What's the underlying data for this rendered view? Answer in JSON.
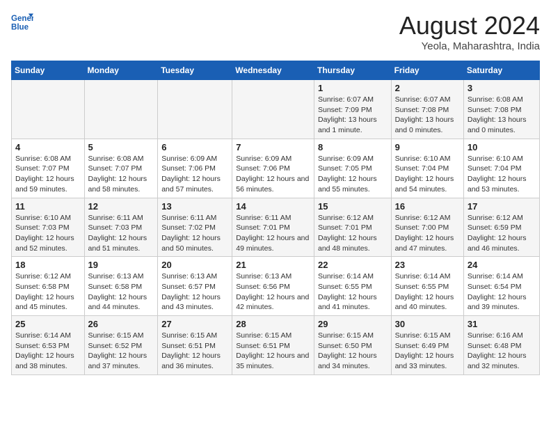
{
  "header": {
    "logo_line1": "General",
    "logo_line2": "Blue",
    "title": "August 2024",
    "subtitle": "Yeola, Maharashtra, India"
  },
  "days_of_week": [
    "Sunday",
    "Monday",
    "Tuesday",
    "Wednesday",
    "Thursday",
    "Friday",
    "Saturday"
  ],
  "weeks": [
    [
      {
        "num": "",
        "sunrise": "",
        "sunset": "",
        "daylight": ""
      },
      {
        "num": "",
        "sunrise": "",
        "sunset": "",
        "daylight": ""
      },
      {
        "num": "",
        "sunrise": "",
        "sunset": "",
        "daylight": ""
      },
      {
        "num": "",
        "sunrise": "",
        "sunset": "",
        "daylight": ""
      },
      {
        "num": "1",
        "sunrise": "Sunrise: 6:07 AM",
        "sunset": "Sunset: 7:09 PM",
        "daylight": "Daylight: 13 hours and 1 minute."
      },
      {
        "num": "2",
        "sunrise": "Sunrise: 6:07 AM",
        "sunset": "Sunset: 7:08 PM",
        "daylight": "Daylight: 13 hours and 0 minutes."
      },
      {
        "num": "3",
        "sunrise": "Sunrise: 6:08 AM",
        "sunset": "Sunset: 7:08 PM",
        "daylight": "Daylight: 13 hours and 0 minutes."
      }
    ],
    [
      {
        "num": "4",
        "sunrise": "Sunrise: 6:08 AM",
        "sunset": "Sunset: 7:07 PM",
        "daylight": "Daylight: 12 hours and 59 minutes."
      },
      {
        "num": "5",
        "sunrise": "Sunrise: 6:08 AM",
        "sunset": "Sunset: 7:07 PM",
        "daylight": "Daylight: 12 hours and 58 minutes."
      },
      {
        "num": "6",
        "sunrise": "Sunrise: 6:09 AM",
        "sunset": "Sunset: 7:06 PM",
        "daylight": "Daylight: 12 hours and 57 minutes."
      },
      {
        "num": "7",
        "sunrise": "Sunrise: 6:09 AM",
        "sunset": "Sunset: 7:06 PM",
        "daylight": "Daylight: 12 hours and 56 minutes."
      },
      {
        "num": "8",
        "sunrise": "Sunrise: 6:09 AM",
        "sunset": "Sunset: 7:05 PM",
        "daylight": "Daylight: 12 hours and 55 minutes."
      },
      {
        "num": "9",
        "sunrise": "Sunrise: 6:10 AM",
        "sunset": "Sunset: 7:04 PM",
        "daylight": "Daylight: 12 hours and 54 minutes."
      },
      {
        "num": "10",
        "sunrise": "Sunrise: 6:10 AM",
        "sunset": "Sunset: 7:04 PM",
        "daylight": "Daylight: 12 hours and 53 minutes."
      }
    ],
    [
      {
        "num": "11",
        "sunrise": "Sunrise: 6:10 AM",
        "sunset": "Sunset: 7:03 PM",
        "daylight": "Daylight: 12 hours and 52 minutes."
      },
      {
        "num": "12",
        "sunrise": "Sunrise: 6:11 AM",
        "sunset": "Sunset: 7:03 PM",
        "daylight": "Daylight: 12 hours and 51 minutes."
      },
      {
        "num": "13",
        "sunrise": "Sunrise: 6:11 AM",
        "sunset": "Sunset: 7:02 PM",
        "daylight": "Daylight: 12 hours and 50 minutes."
      },
      {
        "num": "14",
        "sunrise": "Sunrise: 6:11 AM",
        "sunset": "Sunset: 7:01 PM",
        "daylight": "Daylight: 12 hours and 49 minutes."
      },
      {
        "num": "15",
        "sunrise": "Sunrise: 6:12 AM",
        "sunset": "Sunset: 7:01 PM",
        "daylight": "Daylight: 12 hours and 48 minutes."
      },
      {
        "num": "16",
        "sunrise": "Sunrise: 6:12 AM",
        "sunset": "Sunset: 7:00 PM",
        "daylight": "Daylight: 12 hours and 47 minutes."
      },
      {
        "num": "17",
        "sunrise": "Sunrise: 6:12 AM",
        "sunset": "Sunset: 6:59 PM",
        "daylight": "Daylight: 12 hours and 46 minutes."
      }
    ],
    [
      {
        "num": "18",
        "sunrise": "Sunrise: 6:12 AM",
        "sunset": "Sunset: 6:58 PM",
        "daylight": "Daylight: 12 hours and 45 minutes."
      },
      {
        "num": "19",
        "sunrise": "Sunrise: 6:13 AM",
        "sunset": "Sunset: 6:58 PM",
        "daylight": "Daylight: 12 hours and 44 minutes."
      },
      {
        "num": "20",
        "sunrise": "Sunrise: 6:13 AM",
        "sunset": "Sunset: 6:57 PM",
        "daylight": "Daylight: 12 hours and 43 minutes."
      },
      {
        "num": "21",
        "sunrise": "Sunrise: 6:13 AM",
        "sunset": "Sunset: 6:56 PM",
        "daylight": "Daylight: 12 hours and 42 minutes."
      },
      {
        "num": "22",
        "sunrise": "Sunrise: 6:14 AM",
        "sunset": "Sunset: 6:55 PM",
        "daylight": "Daylight: 12 hours and 41 minutes."
      },
      {
        "num": "23",
        "sunrise": "Sunrise: 6:14 AM",
        "sunset": "Sunset: 6:55 PM",
        "daylight": "Daylight: 12 hours and 40 minutes."
      },
      {
        "num": "24",
        "sunrise": "Sunrise: 6:14 AM",
        "sunset": "Sunset: 6:54 PM",
        "daylight": "Daylight: 12 hours and 39 minutes."
      }
    ],
    [
      {
        "num": "25",
        "sunrise": "Sunrise: 6:14 AM",
        "sunset": "Sunset: 6:53 PM",
        "daylight": "Daylight: 12 hours and 38 minutes."
      },
      {
        "num": "26",
        "sunrise": "Sunrise: 6:15 AM",
        "sunset": "Sunset: 6:52 PM",
        "daylight": "Daylight: 12 hours and 37 minutes."
      },
      {
        "num": "27",
        "sunrise": "Sunrise: 6:15 AM",
        "sunset": "Sunset: 6:51 PM",
        "daylight": "Daylight: 12 hours and 36 minutes."
      },
      {
        "num": "28",
        "sunrise": "Sunrise: 6:15 AM",
        "sunset": "Sunset: 6:51 PM",
        "daylight": "Daylight: 12 hours and 35 minutes."
      },
      {
        "num": "29",
        "sunrise": "Sunrise: 6:15 AM",
        "sunset": "Sunset: 6:50 PM",
        "daylight": "Daylight: 12 hours and 34 minutes."
      },
      {
        "num": "30",
        "sunrise": "Sunrise: 6:15 AM",
        "sunset": "Sunset: 6:49 PM",
        "daylight": "Daylight: 12 hours and 33 minutes."
      },
      {
        "num": "31",
        "sunrise": "Sunrise: 6:16 AM",
        "sunset": "Sunset: 6:48 PM",
        "daylight": "Daylight: 12 hours and 32 minutes."
      }
    ]
  ]
}
